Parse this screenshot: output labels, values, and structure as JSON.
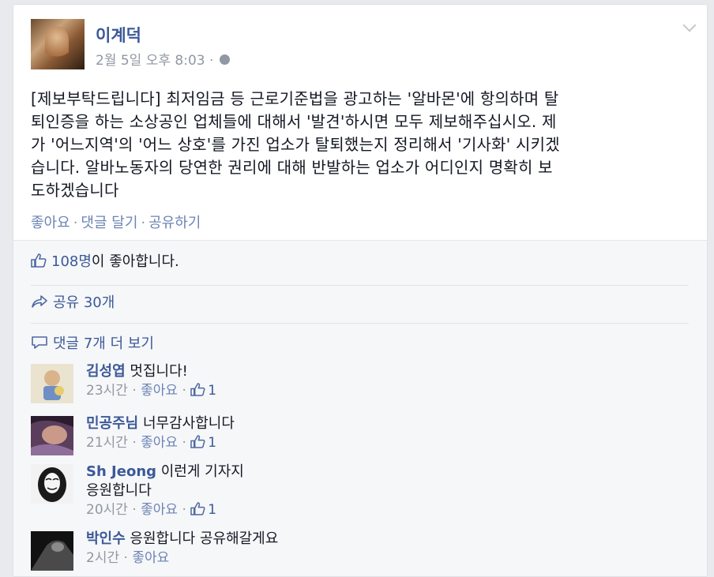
{
  "post": {
    "author": "이계덕",
    "timestamp": "2월 5일 오후 8:03",
    "meta_sep": "·",
    "text_lines": [
      "[제보부탁드립니다] 최저임금 등 근로기준법을 광고하는 '알바몬'에 항의하며 탈",
      "퇴인증을 하는 소상공인 업체들에 대해서 '발견'하시면 모두 제보해주십시오. 제",
      "가 '어느지역'의 '어느 상호'를 가진 업소가 탈퇴했는지 정리해서 '기사화' 시키겠",
      "습니다. 알바노동자의 당연한 권리에 대해 반발하는 업소가 어디인지 명확히 보",
      "도하겠습니다"
    ],
    "actions": {
      "like": "좋아요",
      "comment": "댓글 달기",
      "share": "공유하기",
      "sep": "·"
    }
  },
  "feedback": {
    "likes_count": "108명",
    "likes_suffix": "이 좋아합니다.",
    "shares": "공유 30개",
    "more_comments": "댓글 7개 더 보기"
  },
  "comments": [
    {
      "name": "김성엽",
      "text": "멋집니다!",
      "text2": "",
      "time": "23시간",
      "like": "좋아요",
      "count": "1",
      "sep": "·",
      "avatar_color": "#d9c9a8"
    },
    {
      "name": "민공주님",
      "text": "너무감사합니다",
      "text2": "",
      "time": "21시간",
      "like": "좋아요",
      "count": "1",
      "sep": "·",
      "avatar_color": "#7d5a7a"
    },
    {
      "name": "Sh Jeong",
      "text": "이런게 기자지",
      "text2": "응원합니다",
      "time": "20시간",
      "like": "좋아요",
      "count": "1",
      "sep": "·",
      "avatar_color": "#222222"
    },
    {
      "name": "박인수",
      "text": "응원합니다 공유해갈게요",
      "text2": "",
      "time": "2시간",
      "like": "좋아요",
      "count": "",
      "sep": "·",
      "avatar_color": "#3a3a3a"
    }
  ],
  "icons": {
    "globe": "globe-icon",
    "chevron": "chevron-down-icon",
    "like": "thumbs-up-icon",
    "share": "share-arrow-icon",
    "comment": "comment-icon"
  },
  "colors": {
    "link": "#3b5998",
    "meta": "#9197a3",
    "background": "#e9eaed",
    "feedback_bg": "#f6f7f9"
  }
}
